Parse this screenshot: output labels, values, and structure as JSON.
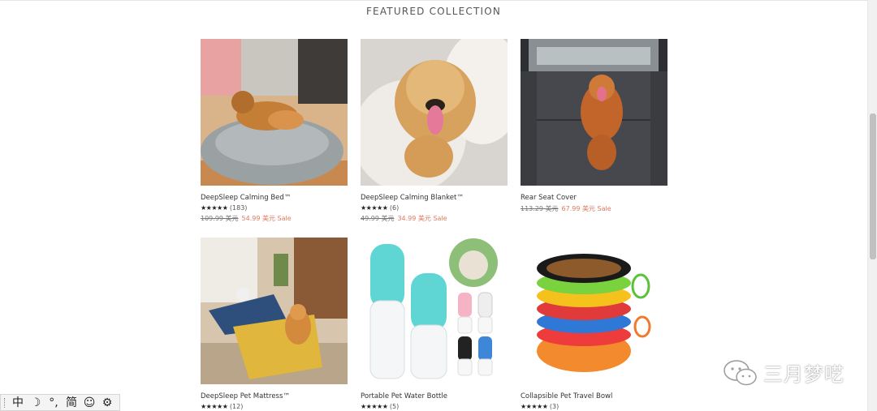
{
  "section": {
    "title": "FEATURED COLLECTION"
  },
  "products": [
    {
      "name": "DeepSleep Calming Bed™",
      "stars": "★★★★★",
      "reviews": "(183)",
      "old_price": "109.99 美元",
      "sale_price": "54.99 美元 Sale",
      "image_icon": "dog-on-round-bed"
    },
    {
      "name": "DeepSleep Calming Blanket™",
      "stars": "★★★★★",
      "reviews": "(6)",
      "old_price": "49.99 美元",
      "sale_price": "34.99 美元 Sale",
      "image_icon": "dog-in-fluffy-blanket"
    },
    {
      "name": "Rear Seat Cover",
      "stars": "",
      "reviews": "",
      "old_price": "113.29 美元",
      "sale_price": "67.99 美元 Sale",
      "image_icon": "dog-on-car-seat-cover"
    },
    {
      "name": "DeepSleep Pet Mattress™",
      "stars": "★★★★★",
      "reviews": "(12)",
      "old_price": "",
      "sale_price": "",
      "image_icon": "dog-on-mattress"
    },
    {
      "name": "Portable Pet Water Bottle",
      "stars": "★★★★★",
      "reviews": "(5)",
      "old_price": "",
      "sale_price": "",
      "image_icon": "water-bottles"
    },
    {
      "name": "Collapsible Pet Travel Bowl",
      "stars": "★★★★★",
      "reviews": "(3)",
      "old_price": "",
      "sale_price": "",
      "image_icon": "stacked-bowls"
    }
  ],
  "ime_toolbar": {
    "items": [
      "中",
      "☽",
      "°,",
      "简",
      "☺",
      "⚙"
    ]
  },
  "watermark": {
    "text": "三月梦呓",
    "icon": "wechat-icon"
  }
}
